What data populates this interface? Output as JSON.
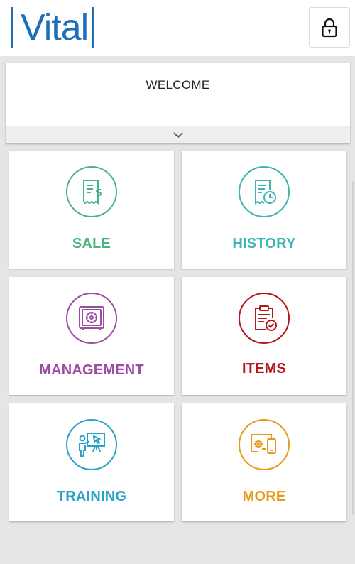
{
  "header": {
    "logo_text": "Vital",
    "brand_color": "#1d6fb8",
    "lock_icon": "lock-icon"
  },
  "welcome": {
    "title": "WELCOME",
    "toggle_icon": "chevron-down-icon"
  },
  "tiles": [
    {
      "label": "SALE",
      "icon": "receipt-dollar-icon",
      "color": "#4bb381"
    },
    {
      "label": "HISTORY",
      "icon": "receipt-clock-icon",
      "color": "#3bb5ae"
    },
    {
      "label": "MANAGEMENT",
      "icon": "safe-icon",
      "color": "#9b4ea2"
    },
    {
      "label": "ITEMS",
      "icon": "clipboard-check-icon",
      "color": "#b3181f"
    },
    {
      "label": "TRAINING",
      "icon": "presenter-board-icon",
      "color": "#2aa1c9"
    },
    {
      "label": "MORE",
      "icon": "devices-gear-icon",
      "color": "#e89a1c"
    }
  ]
}
